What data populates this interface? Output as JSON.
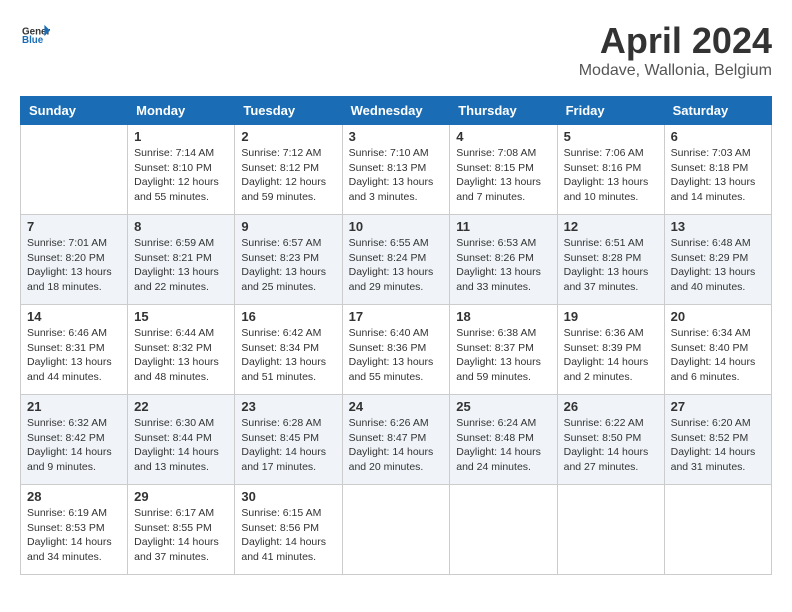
{
  "header": {
    "logo_line1": "General",
    "logo_line2": "Blue",
    "month_title": "April 2024",
    "subtitle": "Modave, Wallonia, Belgium"
  },
  "days_of_week": [
    "Sunday",
    "Monday",
    "Tuesday",
    "Wednesday",
    "Thursday",
    "Friday",
    "Saturday"
  ],
  "weeks": [
    [
      {
        "day": "",
        "info": ""
      },
      {
        "day": "1",
        "info": "Sunrise: 7:14 AM\nSunset: 8:10 PM\nDaylight: 12 hours\nand 55 minutes."
      },
      {
        "day": "2",
        "info": "Sunrise: 7:12 AM\nSunset: 8:12 PM\nDaylight: 12 hours\nand 59 minutes."
      },
      {
        "day": "3",
        "info": "Sunrise: 7:10 AM\nSunset: 8:13 PM\nDaylight: 13 hours\nand 3 minutes."
      },
      {
        "day": "4",
        "info": "Sunrise: 7:08 AM\nSunset: 8:15 PM\nDaylight: 13 hours\nand 7 minutes."
      },
      {
        "day": "5",
        "info": "Sunrise: 7:06 AM\nSunset: 8:16 PM\nDaylight: 13 hours\nand 10 minutes."
      },
      {
        "day": "6",
        "info": "Sunrise: 7:03 AM\nSunset: 8:18 PM\nDaylight: 13 hours\nand 14 minutes."
      }
    ],
    [
      {
        "day": "7",
        "info": "Sunrise: 7:01 AM\nSunset: 8:20 PM\nDaylight: 13 hours\nand 18 minutes."
      },
      {
        "day": "8",
        "info": "Sunrise: 6:59 AM\nSunset: 8:21 PM\nDaylight: 13 hours\nand 22 minutes."
      },
      {
        "day": "9",
        "info": "Sunrise: 6:57 AM\nSunset: 8:23 PM\nDaylight: 13 hours\nand 25 minutes."
      },
      {
        "day": "10",
        "info": "Sunrise: 6:55 AM\nSunset: 8:24 PM\nDaylight: 13 hours\nand 29 minutes."
      },
      {
        "day": "11",
        "info": "Sunrise: 6:53 AM\nSunset: 8:26 PM\nDaylight: 13 hours\nand 33 minutes."
      },
      {
        "day": "12",
        "info": "Sunrise: 6:51 AM\nSunset: 8:28 PM\nDaylight: 13 hours\nand 37 minutes."
      },
      {
        "day": "13",
        "info": "Sunrise: 6:48 AM\nSunset: 8:29 PM\nDaylight: 13 hours\nand 40 minutes."
      }
    ],
    [
      {
        "day": "14",
        "info": "Sunrise: 6:46 AM\nSunset: 8:31 PM\nDaylight: 13 hours\nand 44 minutes."
      },
      {
        "day": "15",
        "info": "Sunrise: 6:44 AM\nSunset: 8:32 PM\nDaylight: 13 hours\nand 48 minutes."
      },
      {
        "day": "16",
        "info": "Sunrise: 6:42 AM\nSunset: 8:34 PM\nDaylight: 13 hours\nand 51 minutes."
      },
      {
        "day": "17",
        "info": "Sunrise: 6:40 AM\nSunset: 8:36 PM\nDaylight: 13 hours\nand 55 minutes."
      },
      {
        "day": "18",
        "info": "Sunrise: 6:38 AM\nSunset: 8:37 PM\nDaylight: 13 hours\nand 59 minutes."
      },
      {
        "day": "19",
        "info": "Sunrise: 6:36 AM\nSunset: 8:39 PM\nDaylight: 14 hours\nand 2 minutes."
      },
      {
        "day": "20",
        "info": "Sunrise: 6:34 AM\nSunset: 8:40 PM\nDaylight: 14 hours\nand 6 minutes."
      }
    ],
    [
      {
        "day": "21",
        "info": "Sunrise: 6:32 AM\nSunset: 8:42 PM\nDaylight: 14 hours\nand 9 minutes."
      },
      {
        "day": "22",
        "info": "Sunrise: 6:30 AM\nSunset: 8:44 PM\nDaylight: 14 hours\nand 13 minutes."
      },
      {
        "day": "23",
        "info": "Sunrise: 6:28 AM\nSunset: 8:45 PM\nDaylight: 14 hours\nand 17 minutes."
      },
      {
        "day": "24",
        "info": "Sunrise: 6:26 AM\nSunset: 8:47 PM\nDaylight: 14 hours\nand 20 minutes."
      },
      {
        "day": "25",
        "info": "Sunrise: 6:24 AM\nSunset: 8:48 PM\nDaylight: 14 hours\nand 24 minutes."
      },
      {
        "day": "26",
        "info": "Sunrise: 6:22 AM\nSunset: 8:50 PM\nDaylight: 14 hours\nand 27 minutes."
      },
      {
        "day": "27",
        "info": "Sunrise: 6:20 AM\nSunset: 8:52 PM\nDaylight: 14 hours\nand 31 minutes."
      }
    ],
    [
      {
        "day": "28",
        "info": "Sunrise: 6:19 AM\nSunset: 8:53 PM\nDaylight: 14 hours\nand 34 minutes."
      },
      {
        "day": "29",
        "info": "Sunrise: 6:17 AM\nSunset: 8:55 PM\nDaylight: 14 hours\nand 37 minutes."
      },
      {
        "day": "30",
        "info": "Sunrise: 6:15 AM\nSunset: 8:56 PM\nDaylight: 14 hours\nand 41 minutes."
      },
      {
        "day": "",
        "info": ""
      },
      {
        "day": "",
        "info": ""
      },
      {
        "day": "",
        "info": ""
      },
      {
        "day": "",
        "info": ""
      }
    ]
  ]
}
